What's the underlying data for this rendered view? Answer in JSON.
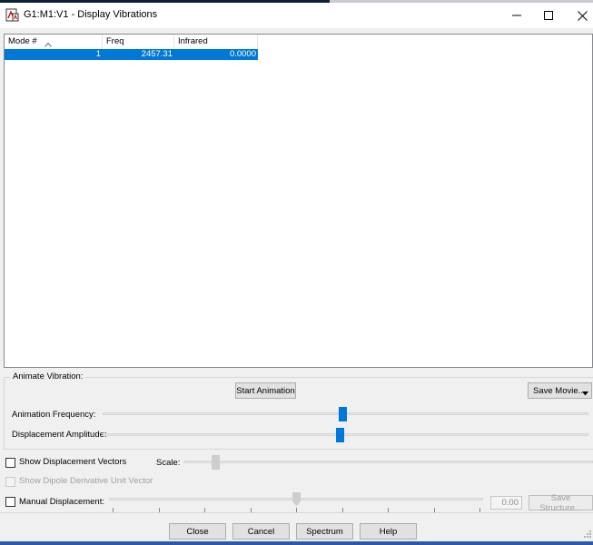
{
  "window": {
    "title": "G1:M1:V1 - Display Vibrations",
    "icons": {
      "app": "gaussview-app-icon",
      "minimize": "minimize-icon",
      "maximize": "maximize-icon",
      "close": "close-icon"
    }
  },
  "list": {
    "columns": [
      "Mode #",
      "Freq",
      "Infrared"
    ],
    "sorted_column": "Mode #",
    "sort_icon": "sort-ascending-icon",
    "rows": [
      {
        "mode": "1",
        "freq": "2457.31",
        "infrared": "0.0000",
        "selected": true
      }
    ]
  },
  "animate": {
    "group_label": "Animate Vibration:",
    "start_label": "Start Animation",
    "save_movie_label": "Save Movie...",
    "save_movie_icon": "dropdown-arrow-icon",
    "frequency_label": "Animation Frequency:",
    "frequency_level": 0.55,
    "amplitude_label": "Displacement Amplitude:",
    "amplitude_level": 0.55
  },
  "options": {
    "show_vectors_label": "Show Displacement Vectors",
    "show_vectors_checked": false,
    "scale_label": "Scale:",
    "scale_level": 0.05,
    "show_dipole_label": "Show Dipole Derivative Unit Vector",
    "show_dipole_enabled": false,
    "manual_label": "Manual Displacement:",
    "manual_checked": false,
    "manual_level": 0.5,
    "manual_value": "0.00",
    "save_structure_label": "Save Structure..."
  },
  "buttons": {
    "close": "Close",
    "cancel": "Cancel",
    "spectrum": "Spectrum",
    "help": "Help"
  },
  "colors": {
    "selection": "#0078d7",
    "slider_thumb": "#0078d7"
  }
}
